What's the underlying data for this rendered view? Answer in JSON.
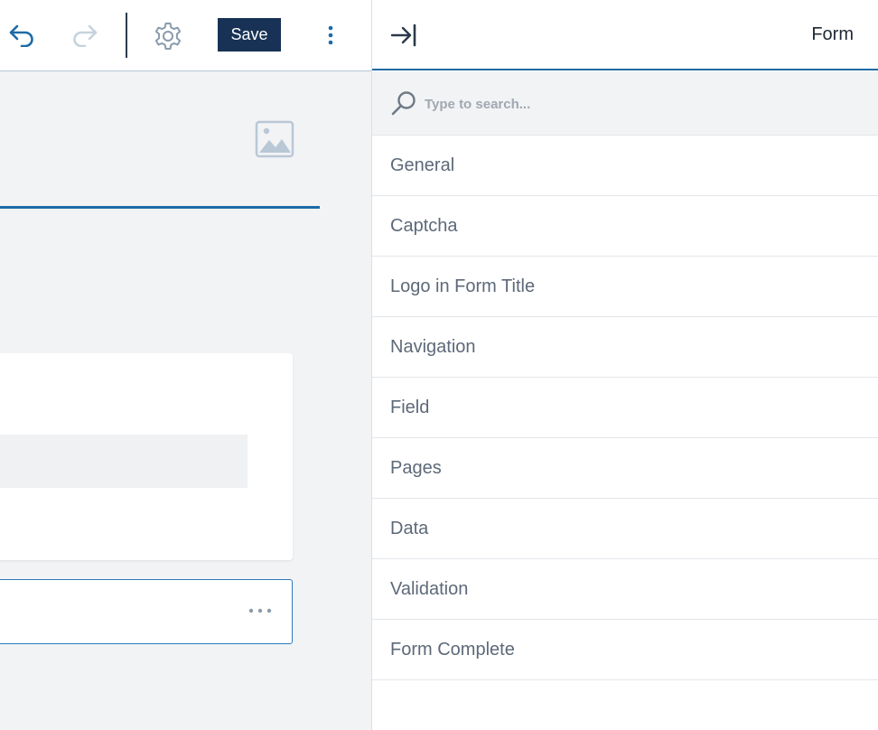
{
  "toolbar": {
    "save_label": "Save",
    "icons": [
      "undo-icon",
      "redo-icon",
      "gear-icon",
      "more-vertical-icon"
    ]
  },
  "panel": {
    "title": "Form",
    "search_placeholder": "Type to search...",
    "items": [
      {
        "label": "General"
      },
      {
        "label": "Captcha"
      },
      {
        "label": "Logo in Form Title"
      },
      {
        "label": "Navigation"
      },
      {
        "label": "Field"
      },
      {
        "label": "Pages"
      },
      {
        "label": "Data"
      },
      {
        "label": "Validation"
      },
      {
        "label": "Form Complete"
      }
    ]
  },
  "colors": {
    "accent": "#1e6aa6",
    "save_bg": "#173255",
    "icon_muted": "#8a9bab",
    "icon_disabled": "#c5d3de",
    "item_text": "#5d6978"
  }
}
